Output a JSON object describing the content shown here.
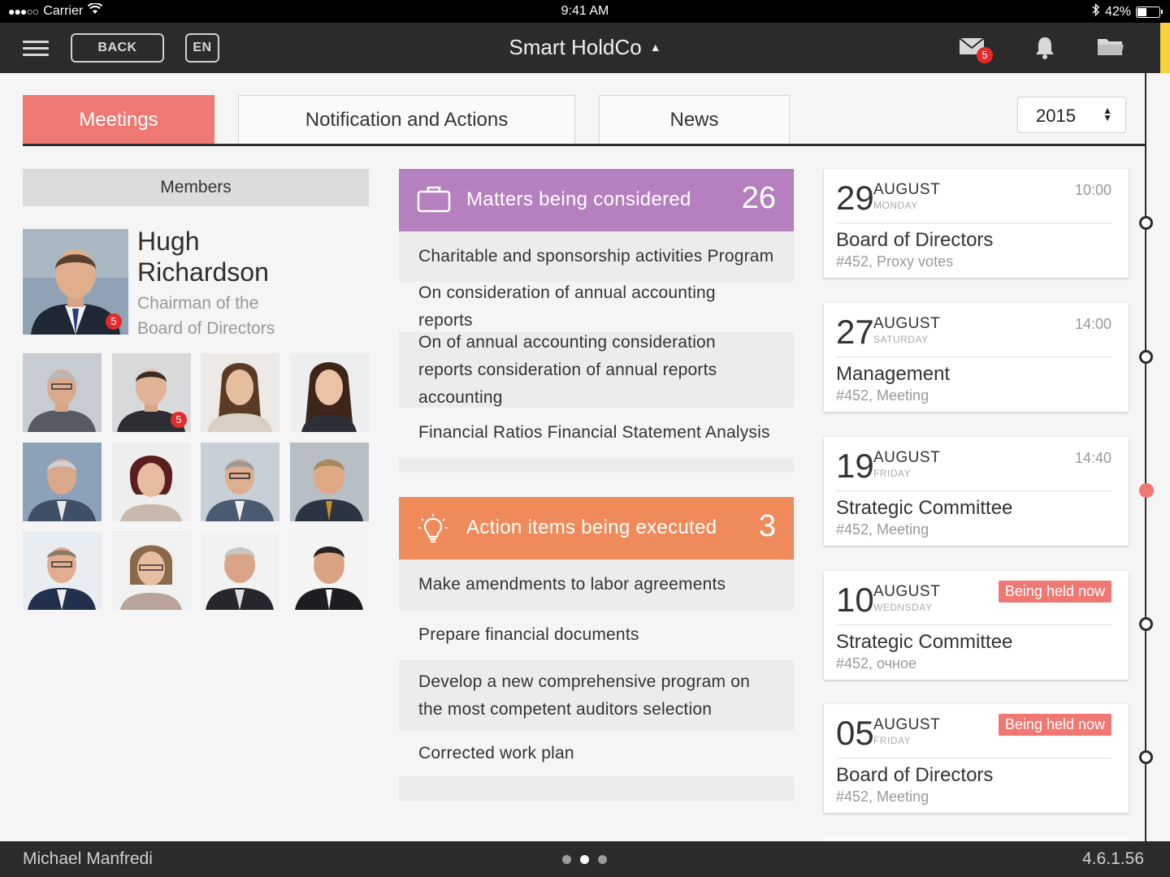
{
  "status_bar": {
    "carrier": "Carrier",
    "time": "9:41 AM",
    "battery": "42%",
    "battery_level": 0.42
  },
  "nav": {
    "back_label": "BACK",
    "lang_label": "EN",
    "title": "Smart HoldCo",
    "mail_badge": "5",
    "accent_color": "#f4d23a"
  },
  "tabs": [
    {
      "label": "Meetings",
      "active": true
    },
    {
      "label": "Notification and Actions",
      "active": false
    },
    {
      "label": "News",
      "active": false
    }
  ],
  "year": "2015",
  "members": {
    "header": "Members",
    "main": {
      "first_name": "Hugh",
      "last_name": "Richardson",
      "role_line1": "Chairman of the",
      "role_line2": "Board of Directors",
      "badge": "5"
    },
    "thumb_badge": "5"
  },
  "matters": {
    "title": "Matters being considered",
    "count": "26",
    "color": "#b67fbf",
    "items": [
      "Charitable and sponsorship activities Program",
      "On consideration of annual accounting reports",
      "On of annual accounting consideration reports consideration of annual reports accounting",
      "Financial Ratios Financial Statement Analysis"
    ]
  },
  "actions": {
    "title": "Action items being executed",
    "count": "3",
    "color": "#ef8a5a",
    "items": [
      "Make amendments to labor agreements",
      "Prepare financial documents",
      "Develop a new comprehensive program on the most competent auditors selection",
      "Corrected work plan"
    ]
  },
  "meetings": [
    {
      "day": "29",
      "month": "AUGUST",
      "weekday": "MONDAY",
      "time": "10:00",
      "title": "Board of Directors",
      "sub": "#452, Proxy votes"
    },
    {
      "day": "27",
      "month": "AUGUST",
      "weekday": "SATURDAY",
      "time": "14:00",
      "title": "Management",
      "sub": "#452, Meeting"
    },
    {
      "day": "19",
      "month": "AUGUST",
      "weekday": "FRIDAY",
      "time": "14:40",
      "title": "Strategic Committee",
      "sub": "#452, Meeting"
    },
    {
      "day": "10",
      "month": "AUGUST",
      "weekday": "WEDNSDAY",
      "status": "Being held now",
      "title": "Strategic Committee",
      "sub": "#452, очное"
    },
    {
      "day": "05",
      "month": "AUGUST",
      "weekday": "FRIDAY",
      "status": "Being held now",
      "title": "Board of Directors",
      "sub": "#452, Meeting"
    }
  ],
  "footer": {
    "user": "Michael Manfredi",
    "version": "4.6.1.56",
    "pages": 3,
    "current_page": 2
  }
}
